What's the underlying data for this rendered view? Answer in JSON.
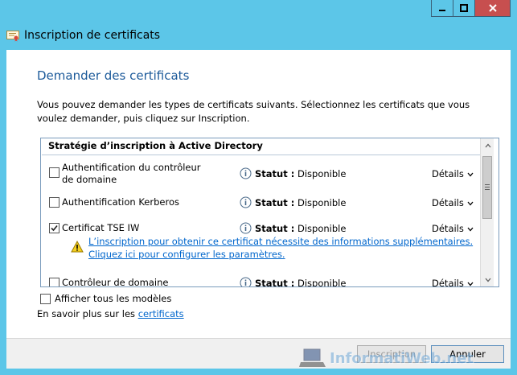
{
  "window": {
    "title": "Inscription de certificats",
    "controls": {
      "minimize_icon": "minimize-icon",
      "maximize_icon": "maximize-icon",
      "close_icon": "close-icon"
    }
  },
  "page": {
    "heading": "Demander des certificats",
    "intro": "Vous pouvez demander les types de certificats suivants. Sélectionnez les certificats que vous voulez demander, puis cliquez sur Inscription."
  },
  "list": {
    "header": "Stratégie d’inscription à Active Directory",
    "status_label": "Statut :",
    "details_label": "Détails",
    "items": [
      {
        "name": "Authentification du contrôleur de domaine",
        "status": "Disponible",
        "checked": false
      },
      {
        "name": "Authentification Kerberos",
        "status": "Disponible",
        "checked": false
      },
      {
        "name": "Certificat TSE IW",
        "status": "Disponible",
        "checked": true,
        "warning_line1": "L’inscription pour obtenir ce certificat nécessite des informations supplémentaires.",
        "warning_line2": "Cliquez ici pour configurer les paramètres."
      },
      {
        "name": "Contrôleur de domaine",
        "status": "Disponible",
        "checked": false
      }
    ]
  },
  "show_all_templates": {
    "label": "Afficher tous les modèles",
    "checked": false
  },
  "learn_more": {
    "prefix": "En savoir plus sur les ",
    "link": "certificats"
  },
  "buttons": {
    "enroll": "Inscription",
    "cancel": "Annuler"
  },
  "watermark": "InformatiWeb.net",
  "colors": {
    "title_bar": "#5cc6e8",
    "heading": "#1c5a9a",
    "link": "#0066cc",
    "close_button": "#c74f4f"
  }
}
